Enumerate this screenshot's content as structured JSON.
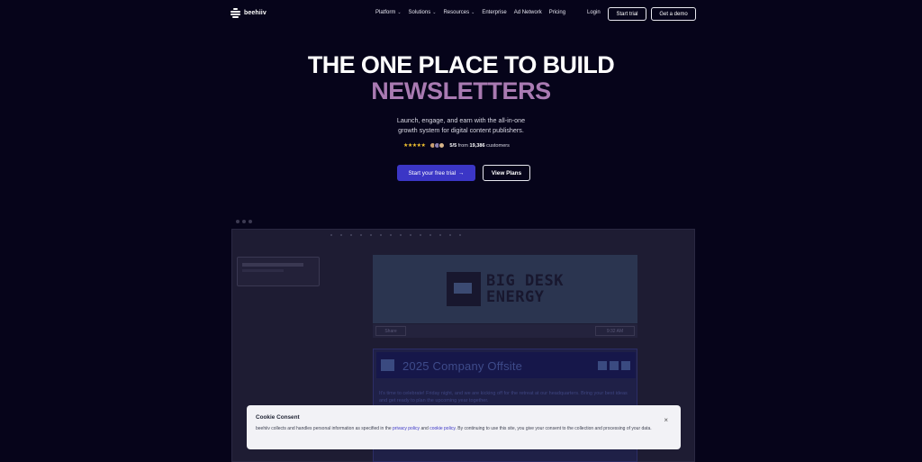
{
  "nav": {
    "logo_text": "beehiiv",
    "links": [
      {
        "label": "Platform",
        "has_dropdown": true
      },
      {
        "label": "Solutions",
        "has_dropdown": true
      },
      {
        "label": "Resources",
        "has_dropdown": true
      },
      {
        "label": "Enterprise",
        "has_dropdown": false
      },
      {
        "label": "Ad Network",
        "has_dropdown": false
      },
      {
        "label": "Pricing",
        "has_dropdown": false
      }
    ],
    "login": "Login",
    "start_trial": "Start trial",
    "get_demo": "Get a demo"
  },
  "hero": {
    "title_line1": "THE ONE PLACE TO BUILD",
    "title_line2": "NEWSLETTERS",
    "subtitle_line1": "Launch, engage, and earn with the all-in-one",
    "subtitle_line2": "growth system for digital content publishers.",
    "stars": "★★★★★",
    "rating_value": "5/5",
    "rating_from": "from",
    "rating_count": "19,386",
    "rating_suffix": "customers",
    "cta_primary": "Start your free trial",
    "cta_primary_arrow": "→",
    "cta_secondary": "View Plans"
  },
  "preview": {
    "banner_line1": "BIG DESK",
    "banner_line2": "ENERGY",
    "share_label": "Share",
    "time_label": "9:32 AM",
    "event_title": "2025 Company Offsite",
    "event_body": "It's time to celebrate! Friday night, and we are kicking off for the retreat at our headquarters. Bring your best ideas and get ready to plan the upcoming year together."
  },
  "cookie": {
    "title": "Cookie Consent",
    "close": "×",
    "text_before": "beehiiv collects and handles personal information as specified in the",
    "privacy_link": "privacy policy",
    "and": "and",
    "cookie_link": "cookie policy",
    "text_after": ". By continuing to use this site, you give your consent to the collection and processing of your data."
  },
  "colors": {
    "background": "#06041a",
    "accent": "#3b36c6",
    "gradient_text": "#a97ab2",
    "star": "#f4c430"
  }
}
